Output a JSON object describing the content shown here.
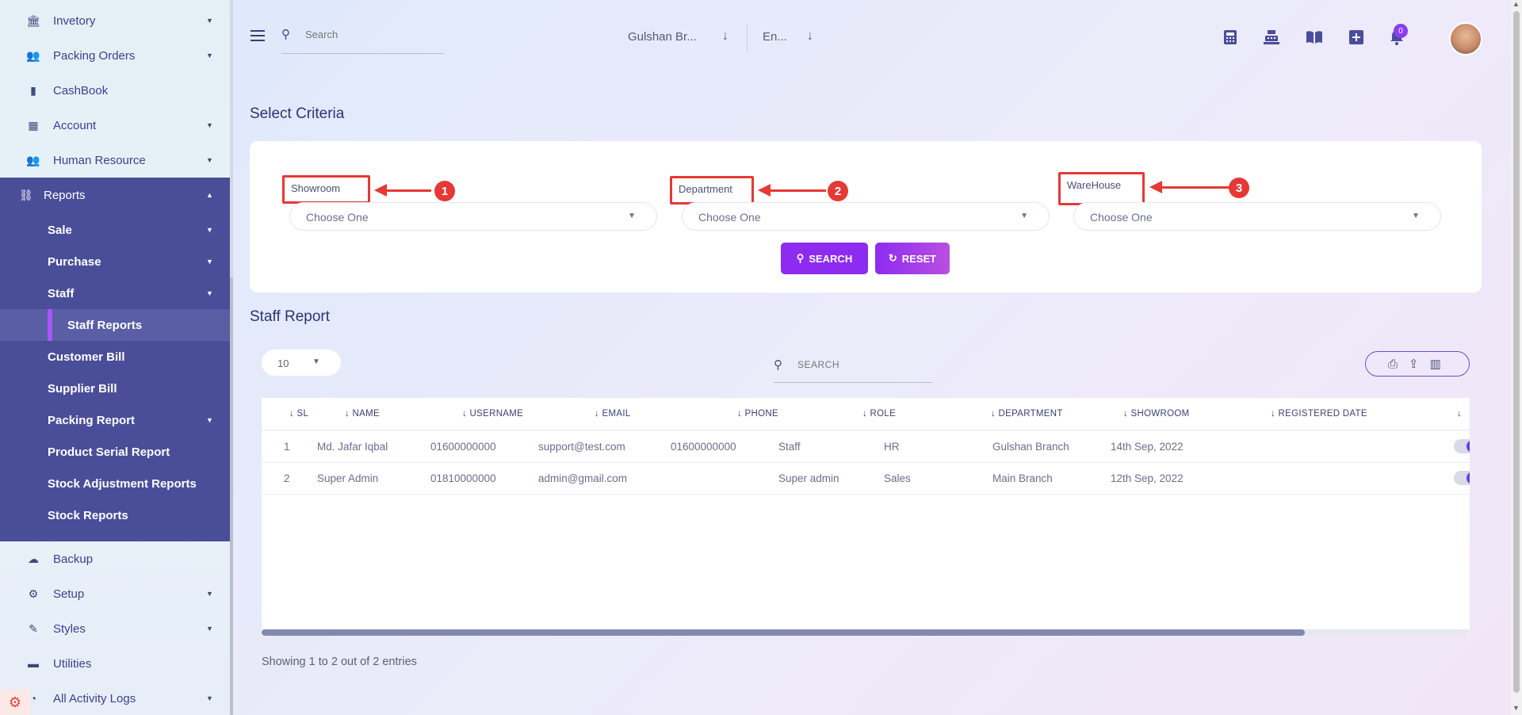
{
  "sidebar": {
    "items_top": [
      {
        "label": "Invetory",
        "icon": "bank-icon",
        "caret": true
      },
      {
        "label": "Packing Orders",
        "icon": "users-icon",
        "caret": true
      },
      {
        "label": "CashBook",
        "icon": "book-icon",
        "caret": false
      },
      {
        "label": "Account",
        "icon": "calculator-icon",
        "caret": true
      },
      {
        "label": "Human Resource",
        "icon": "users-icon",
        "caret": true
      }
    ],
    "reports": {
      "label": "Reports",
      "icon": "reports-icon"
    },
    "sub_items": [
      {
        "label": "Sale",
        "caret": true
      },
      {
        "label": "Purchase",
        "caret": true
      },
      {
        "label": "Staff",
        "caret": true
      },
      {
        "label": "Staff Reports",
        "caret": false,
        "active": true
      },
      {
        "label": "Customer Bill",
        "caret": false
      },
      {
        "label": "Supplier Bill",
        "caret": false
      },
      {
        "label": "Packing Report",
        "caret": true
      },
      {
        "label": "Product Serial Report",
        "caret": false
      },
      {
        "label": "Stock Adjustment Reports",
        "caret": false
      },
      {
        "label": "Stock Reports",
        "caret": false
      }
    ],
    "items_bottom": [
      {
        "label": "Backup",
        "icon": "cloud-download-icon",
        "caret": false
      },
      {
        "label": "Setup",
        "icon": "gear-icon",
        "caret": true
      },
      {
        "label": "Styles",
        "icon": "brush-icon",
        "caret": true
      },
      {
        "label": "Utilities",
        "icon": "box-icon",
        "caret": false
      },
      {
        "label": "All Activity Logs",
        "icon": "history-icon",
        "caret": true
      }
    ]
  },
  "header": {
    "search_placeholder": "Search",
    "branch": "Gulshan Br...",
    "language": "En...",
    "notification_count": "0",
    "icons": [
      "calculator-icon",
      "cash-register-icon",
      "book-open-icon",
      "plus-square-icon",
      "bell-icon"
    ]
  },
  "criteria": {
    "title": "Select Criteria",
    "fields": [
      {
        "label": "Showroom",
        "value": "Choose One",
        "callout": "1"
      },
      {
        "label": "Department",
        "value": "Choose One",
        "callout": "2"
      },
      {
        "label": "WareHouse",
        "value": "Choose One",
        "callout": "3"
      }
    ],
    "search_label": "SEARCH",
    "reset_label": "RESET"
  },
  "report": {
    "title": "Staff Report",
    "page_length": "10",
    "search_placeholder": "SEARCH",
    "columns": [
      "SL",
      "NAME",
      "USERNAME",
      "EMAIL",
      "PHONE",
      "ROLE",
      "DEPARTMENT",
      "SHOWROOM",
      "REGISTERED DATE"
    ],
    "rows": [
      [
        "1",
        "Md. Jafar Iqbal",
        "01600000000",
        "support@test.com",
        "01600000000",
        "Staff",
        "HR",
        "Gulshan Branch",
        "14th Sep, 2022"
      ],
      [
        "2",
        "Super Admin",
        "01810000000",
        "admin@gmail.com",
        "",
        "Super admin",
        "Sales",
        "Main Branch",
        "12th Sep, 2022"
      ]
    ],
    "info": "Showing 1 to 2 out of 2 entries"
  },
  "colors": {
    "sidebar_active": "#4a4e99",
    "accent": "#8d2cf0",
    "callout": "#e53935"
  }
}
